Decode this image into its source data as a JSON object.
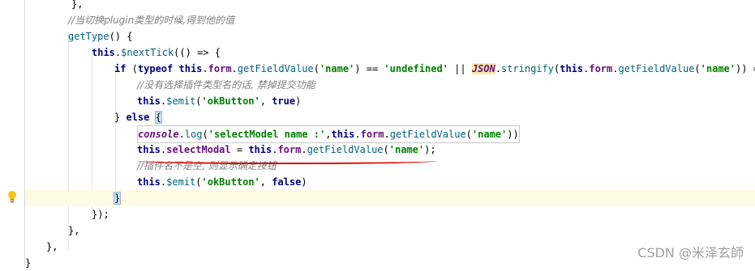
{
  "editor": {
    "lines": [
      {
        "id": "l1",
        "segments": [
          {
            "t": "},",
            "c": ""
          }
        ]
      },
      {
        "id": "l2",
        "segments": [
          {
            "t": "//当切换plugin类型的时候,得到他的值",
            "c": "cmt"
          }
        ]
      },
      {
        "id": "l3",
        "segments": [
          {
            "t": "getType",
            "c": "fn"
          },
          {
            "t": "() {",
            "c": ""
          }
        ]
      },
      {
        "id": "l4",
        "segments": [
          {
            "t": "this",
            "c": "kw"
          },
          {
            "t": ".",
            "c": ""
          },
          {
            "t": "$nextTick",
            "c": "fn"
          },
          {
            "t": "(() => {",
            "c": ""
          }
        ]
      },
      {
        "id": "l5",
        "segments": [
          {
            "t": "if",
            "c": "kw"
          },
          {
            "t": " (",
            "c": ""
          },
          {
            "t": "typeof",
            "c": "kw"
          },
          {
            "t": " ",
            "c": ""
          },
          {
            "t": "this",
            "c": "kw"
          },
          {
            "t": ".",
            "c": ""
          },
          {
            "t": "form",
            "c": "prop"
          },
          {
            "t": ".",
            "c": ""
          },
          {
            "t": "getFieldValue",
            "c": "fn"
          },
          {
            "t": "(",
            "c": ""
          },
          {
            "t": "'name'",
            "c": "str"
          },
          {
            "t": ") == ",
            "c": ""
          },
          {
            "t": "'undefined'",
            "c": "str"
          },
          {
            "t": " || ",
            "c": ""
          },
          {
            "t": "JSON",
            "c": "json"
          },
          {
            "t": ".",
            "c": ""
          },
          {
            "t": "stringify",
            "c": "fn"
          },
          {
            "t": "(",
            "c": ""
          },
          {
            "t": "this",
            "c": "kw"
          },
          {
            "t": ".",
            "c": ""
          },
          {
            "t": "form",
            "c": "prop"
          },
          {
            "t": ".",
            "c": ""
          },
          {
            "t": "getFieldValue",
            "c": "fn"
          },
          {
            "t": "(",
            "c": ""
          },
          {
            "t": "'name'",
            "c": "str"
          },
          {
            "t": ")) == ",
            "c": ""
          },
          {
            "t": "\"",
            "c": "str"
          }
        ]
      },
      {
        "id": "l6",
        "segments": [
          {
            "t": "//没有选择插件类型名的话, 禁掉提交功能",
            "c": "cmt"
          }
        ]
      },
      {
        "id": "l7",
        "segments": [
          {
            "t": "this",
            "c": "kw"
          },
          {
            "t": ".",
            "c": ""
          },
          {
            "t": "$emit",
            "c": "fn"
          },
          {
            "t": "(",
            "c": ""
          },
          {
            "t": "'okButton'",
            "c": "str"
          },
          {
            "t": ", ",
            "c": ""
          },
          {
            "t": "true",
            "c": "kw"
          },
          {
            "t": ")",
            "c": ""
          }
        ]
      },
      {
        "id": "l8",
        "segments": [
          {
            "t": "} ",
            "c": ""
          },
          {
            "t": "else",
            "c": "kw"
          },
          {
            "t": " ",
            "c": ""
          },
          {
            "t": "{",
            "c": "brace-hl"
          }
        ]
      },
      {
        "id": "l9",
        "segments": [
          {
            "t": "console",
            "c": "glob"
          },
          {
            "t": ".",
            "c": ""
          },
          {
            "t": "log",
            "c": "fn"
          },
          {
            "t": "(",
            "c": ""
          },
          {
            "t": "'selectModel name :'",
            "c": "str"
          },
          {
            "t": ",",
            "c": ""
          },
          {
            "t": "this",
            "c": "kw"
          },
          {
            "t": ".",
            "c": ""
          },
          {
            "t": "form",
            "c": "prop"
          },
          {
            "t": ".",
            "c": ""
          },
          {
            "t": "getFieldValue",
            "c": "fn"
          },
          {
            "t": "(",
            "c": ""
          },
          {
            "t": "'name'",
            "c": "str"
          },
          {
            "t": "))",
            "c": ""
          }
        ]
      },
      {
        "id": "l10",
        "segments": [
          {
            "t": "this",
            "c": "kw"
          },
          {
            "t": ".",
            "c": ""
          },
          {
            "t": "selectModal",
            "c": "prop"
          },
          {
            "t": " = ",
            "c": ""
          },
          {
            "t": "this",
            "c": "kw"
          },
          {
            "t": ".",
            "c": ""
          },
          {
            "t": "form",
            "c": "prop"
          },
          {
            "t": ".",
            "c": ""
          },
          {
            "t": "getFieldValue",
            "c": "fn"
          },
          {
            "t": "(",
            "c": ""
          },
          {
            "t": "'name'",
            "c": "str"
          },
          {
            "t": ");",
            "c": ""
          }
        ]
      },
      {
        "id": "l11",
        "segments": [
          {
            "t": "//插件名不是空, 则显示确定按钮",
            "c": "cmt"
          }
        ]
      },
      {
        "id": "l12",
        "segments": [
          {
            "t": "this",
            "c": "kw"
          },
          {
            "t": ".",
            "c": ""
          },
          {
            "t": "$emit",
            "c": "fn"
          },
          {
            "t": "(",
            "c": ""
          },
          {
            "t": "'okButton'",
            "c": "str"
          },
          {
            "t": ", ",
            "c": ""
          },
          {
            "t": "false",
            "c": "kw"
          },
          {
            "t": ")",
            "c": ""
          }
        ]
      },
      {
        "id": "l13",
        "segments": [
          {
            "t": "}",
            "c": "brace-hl"
          }
        ]
      },
      {
        "id": "l14",
        "segments": [
          {
            "t": "});",
            "c": ""
          }
        ]
      },
      {
        "id": "l15",
        "segments": [
          {
            "t": "},",
            "c": ""
          }
        ]
      },
      {
        "id": "l16",
        "segments": [
          {
            "t": "},",
            "c": ""
          }
        ]
      },
      {
        "id": "l17",
        "segments": [
          {
            "t": "}",
            "c": ""
          }
        ]
      }
    ]
  },
  "gutter": {
    "icon": "lightbulb-icon"
  },
  "watermark": "CSDN @米泽玄師"
}
